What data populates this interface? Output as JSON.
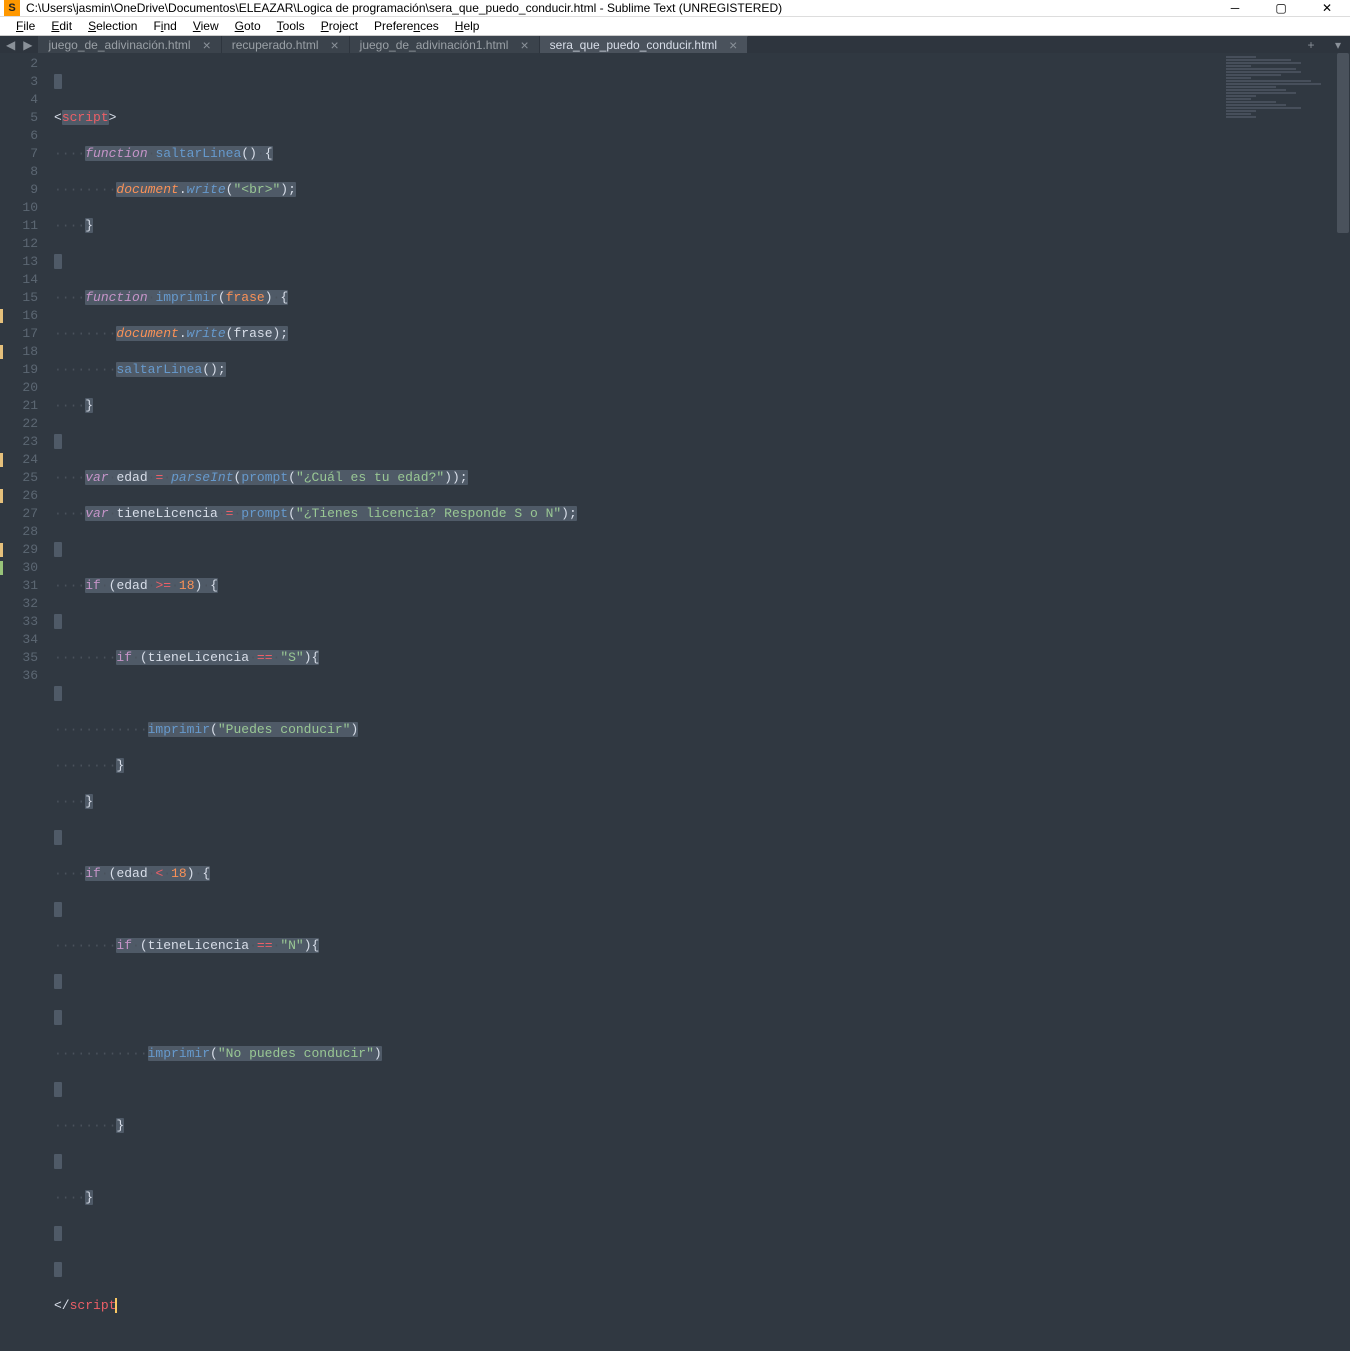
{
  "window": {
    "title": "C:\\Users\\jasmin\\OneDrive\\Documentos\\ELEAZAR\\Logica de programación\\sera_que_puedo_conducir.html - Sublime Text (UNREGISTERED)"
  },
  "menu": {
    "file": "File",
    "edit": "Edit",
    "selection": "Selection",
    "find": "Find",
    "view": "View",
    "goto": "Goto",
    "tools": "Tools",
    "project": "Project",
    "preferences": "Preferences",
    "help": "Help"
  },
  "tabs": {
    "t0": "juego_de_adivinación.html",
    "t1": "recuperado.html",
    "t2": "juego_de_adivinación1.html",
    "t3": "sera_que_puedo_conducir.html",
    "close": "×",
    "add": "+"
  },
  "lines": {
    "l2": "2",
    "l3": "3",
    "l4": "4",
    "l5": "5",
    "l6": "6",
    "l7": "7",
    "l8": "8",
    "l9": "9",
    "l10": "10",
    "l11": "11",
    "l12": "12",
    "l13": "13",
    "l14": "14",
    "l15": "15",
    "l16": "16",
    "l17": "17",
    "l18": "18",
    "l19": "19",
    "l20": "20",
    "l21": "21",
    "l22": "22",
    "l23": "23",
    "l24": "24",
    "l25": "25",
    "l26": "26",
    "l27": "27",
    "l28": "28",
    "l29": "29",
    "l30": "30",
    "l31": "31",
    "l32": "32",
    "l33": "33",
    "l34": "34",
    "l35": "35",
    "l36": "36"
  },
  "code": {
    "script_open": "script",
    "script_close": "script",
    "function": "function",
    "saltarLinea": "saltarLinea",
    "imprimir_fn": "imprimir",
    "document": "document",
    "write": "write",
    "br_str": "\"<br>\"",
    "frase": "frase",
    "var": "var",
    "edad": "edad",
    "parseInt": "parseInt",
    "prompt": "prompt",
    "q_edad": "\"¿Cuál es tu edad?\"",
    "tieneLicencia": "tieneLicencia",
    "q_lic": "\"¿Tienes licencia? Responde S o N\"",
    "if": "if",
    "ge": ">=",
    "n18": "18",
    "eq": "==",
    "S": "\"S\"",
    "puedes": "\"Puedes conducir\"",
    "lt": "<",
    "N": "\"N\"",
    "nopuedes": "\"No puedes conducir\""
  }
}
